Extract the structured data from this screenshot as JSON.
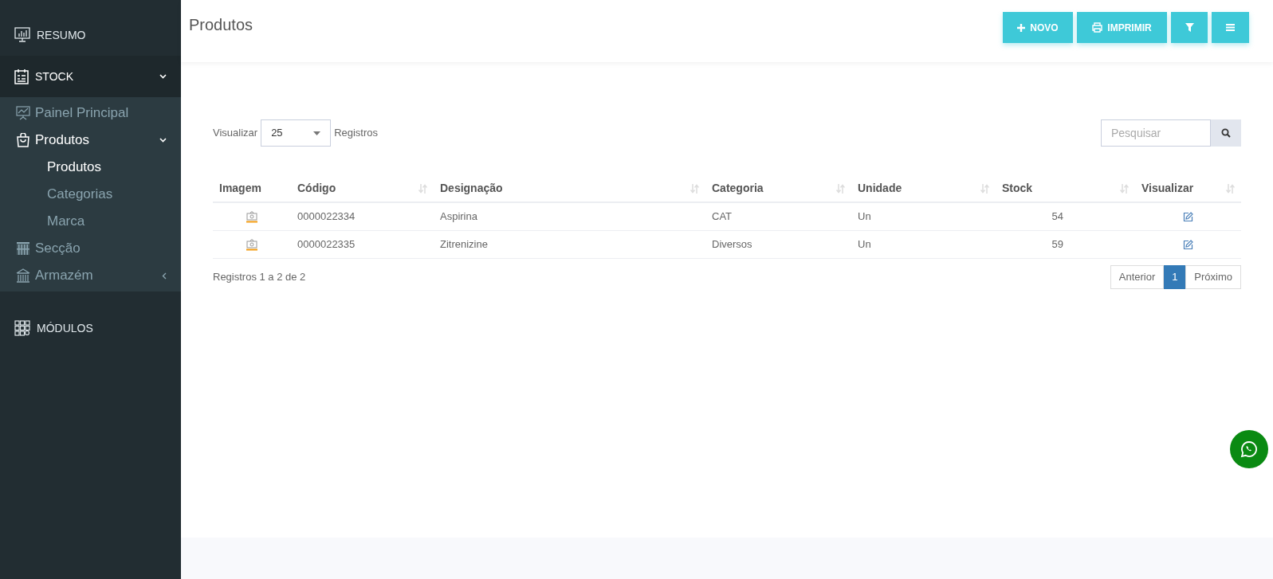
{
  "sidebar": {
    "items": [
      {
        "label": "RESUMO"
      },
      {
        "label": "STOCK",
        "expanded": true,
        "children": [
          {
            "label": "Painel Principal"
          },
          {
            "label": "Produtos",
            "expanded": true,
            "children": [
              {
                "label": "Produtos",
                "selected": true
              },
              {
                "label": "Categorias",
                "selected": false
              },
              {
                "label": "Marca",
                "selected": false
              }
            ]
          },
          {
            "label": "Secção"
          },
          {
            "label": "Armazém",
            "expanded": false
          }
        ]
      },
      {
        "label": "MÓDULOS"
      }
    ]
  },
  "header": {
    "title": "Produtos",
    "buttons": [
      {
        "kind": "new",
        "label": "NOVO"
      },
      {
        "kind": "print",
        "label": "IMPRIMIR"
      },
      {
        "kind": "filter"
      },
      {
        "kind": "menu"
      }
    ]
  },
  "length": {
    "before": "Visualizar",
    "value": "25",
    "after": "Registros"
  },
  "search": {
    "placeholder": "Pesquisar"
  },
  "table": {
    "columns": [
      {
        "label": "Imagem",
        "sortable": false
      },
      {
        "label": "Código",
        "sortable": true
      },
      {
        "label": "Designação",
        "sortable": true
      },
      {
        "label": "Categoria",
        "sortable": true
      },
      {
        "label": "Unidade",
        "sortable": true
      },
      {
        "label": "Stock",
        "sortable": true
      },
      {
        "label": "Visualizar",
        "sortable": true
      }
    ],
    "rows": [
      {
        "code": "0000022334",
        "name": "Aspirina",
        "category": "CAT",
        "unit": "Un",
        "stock": "54"
      },
      {
        "code": "0000022335",
        "name": "Zitrenizine",
        "category": "Diversos",
        "unit": "Un",
        "stock": "59"
      }
    ]
  },
  "info": "Registros 1 a 2 de 2",
  "pagination": {
    "previous": "Anterior",
    "pages": [
      {
        "label": "1",
        "selected": true
      }
    ],
    "next": "Próximo"
  }
}
